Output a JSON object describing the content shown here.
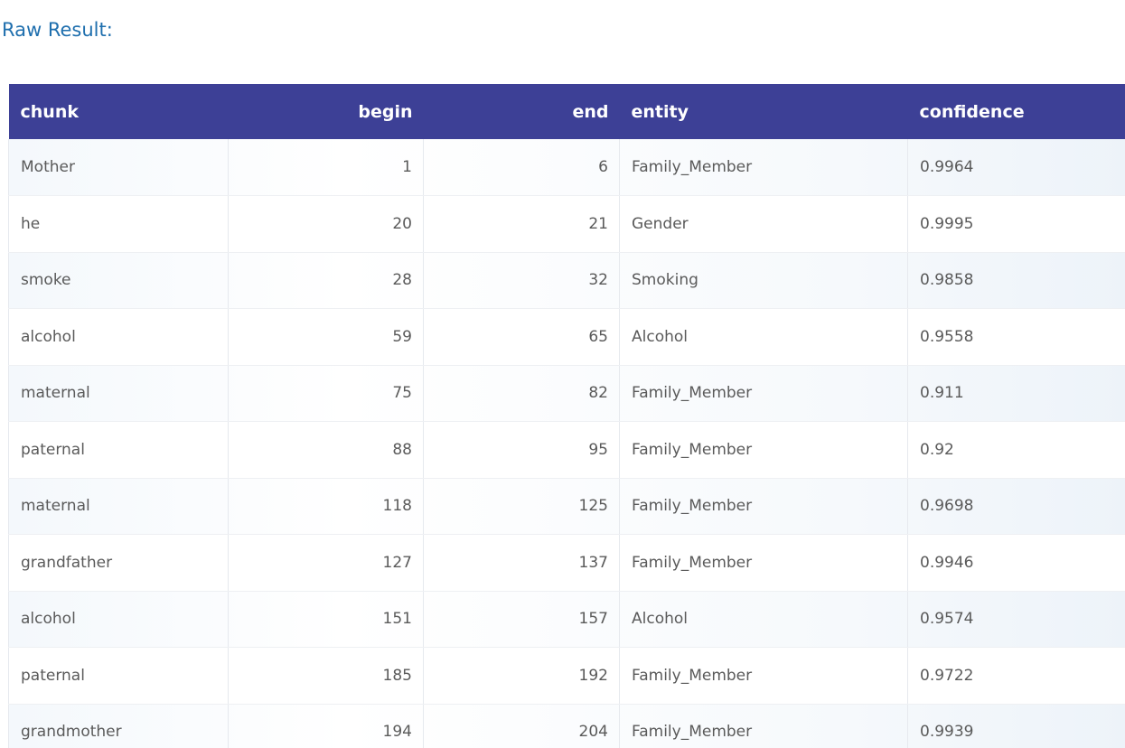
{
  "title": "Raw Result:",
  "table": {
    "headers": [
      "chunk",
      "begin",
      "end",
      "entity",
      "confidence"
    ],
    "rows": [
      {
        "chunk": "Mother",
        "begin": "1",
        "end": "6",
        "entity": "Family_Member",
        "confidence": "0.9964"
      },
      {
        "chunk": "he",
        "begin": "20",
        "end": "21",
        "entity": "Gender",
        "confidence": "0.9995"
      },
      {
        "chunk": "smoke",
        "begin": "28",
        "end": "32",
        "entity": "Smoking",
        "confidence": "0.9858"
      },
      {
        "chunk": "alcohol",
        "begin": "59",
        "end": "65",
        "entity": "Alcohol",
        "confidence": "0.9558"
      },
      {
        "chunk": "maternal",
        "begin": "75",
        "end": "82",
        "entity": "Family_Member",
        "confidence": "0.911"
      },
      {
        "chunk": "paternal",
        "begin": "88",
        "end": "95",
        "entity": "Family_Member",
        "confidence": "0.92"
      },
      {
        "chunk": "maternal",
        "begin": "118",
        "end": "125",
        "entity": "Family_Member",
        "confidence": "0.9698"
      },
      {
        "chunk": "grandfather",
        "begin": "127",
        "end": "137",
        "entity": "Family_Member",
        "confidence": "0.9946"
      },
      {
        "chunk": "alcohol",
        "begin": "151",
        "end": "157",
        "entity": "Alcohol",
        "confidence": "0.9574"
      },
      {
        "chunk": "paternal",
        "begin": "185",
        "end": "192",
        "entity": "Family_Member",
        "confidence": "0.9722"
      },
      {
        "chunk": "grandmother",
        "begin": "194",
        "end": "204",
        "entity": "Family_Member",
        "confidence": "0.9939"
      }
    ]
  }
}
